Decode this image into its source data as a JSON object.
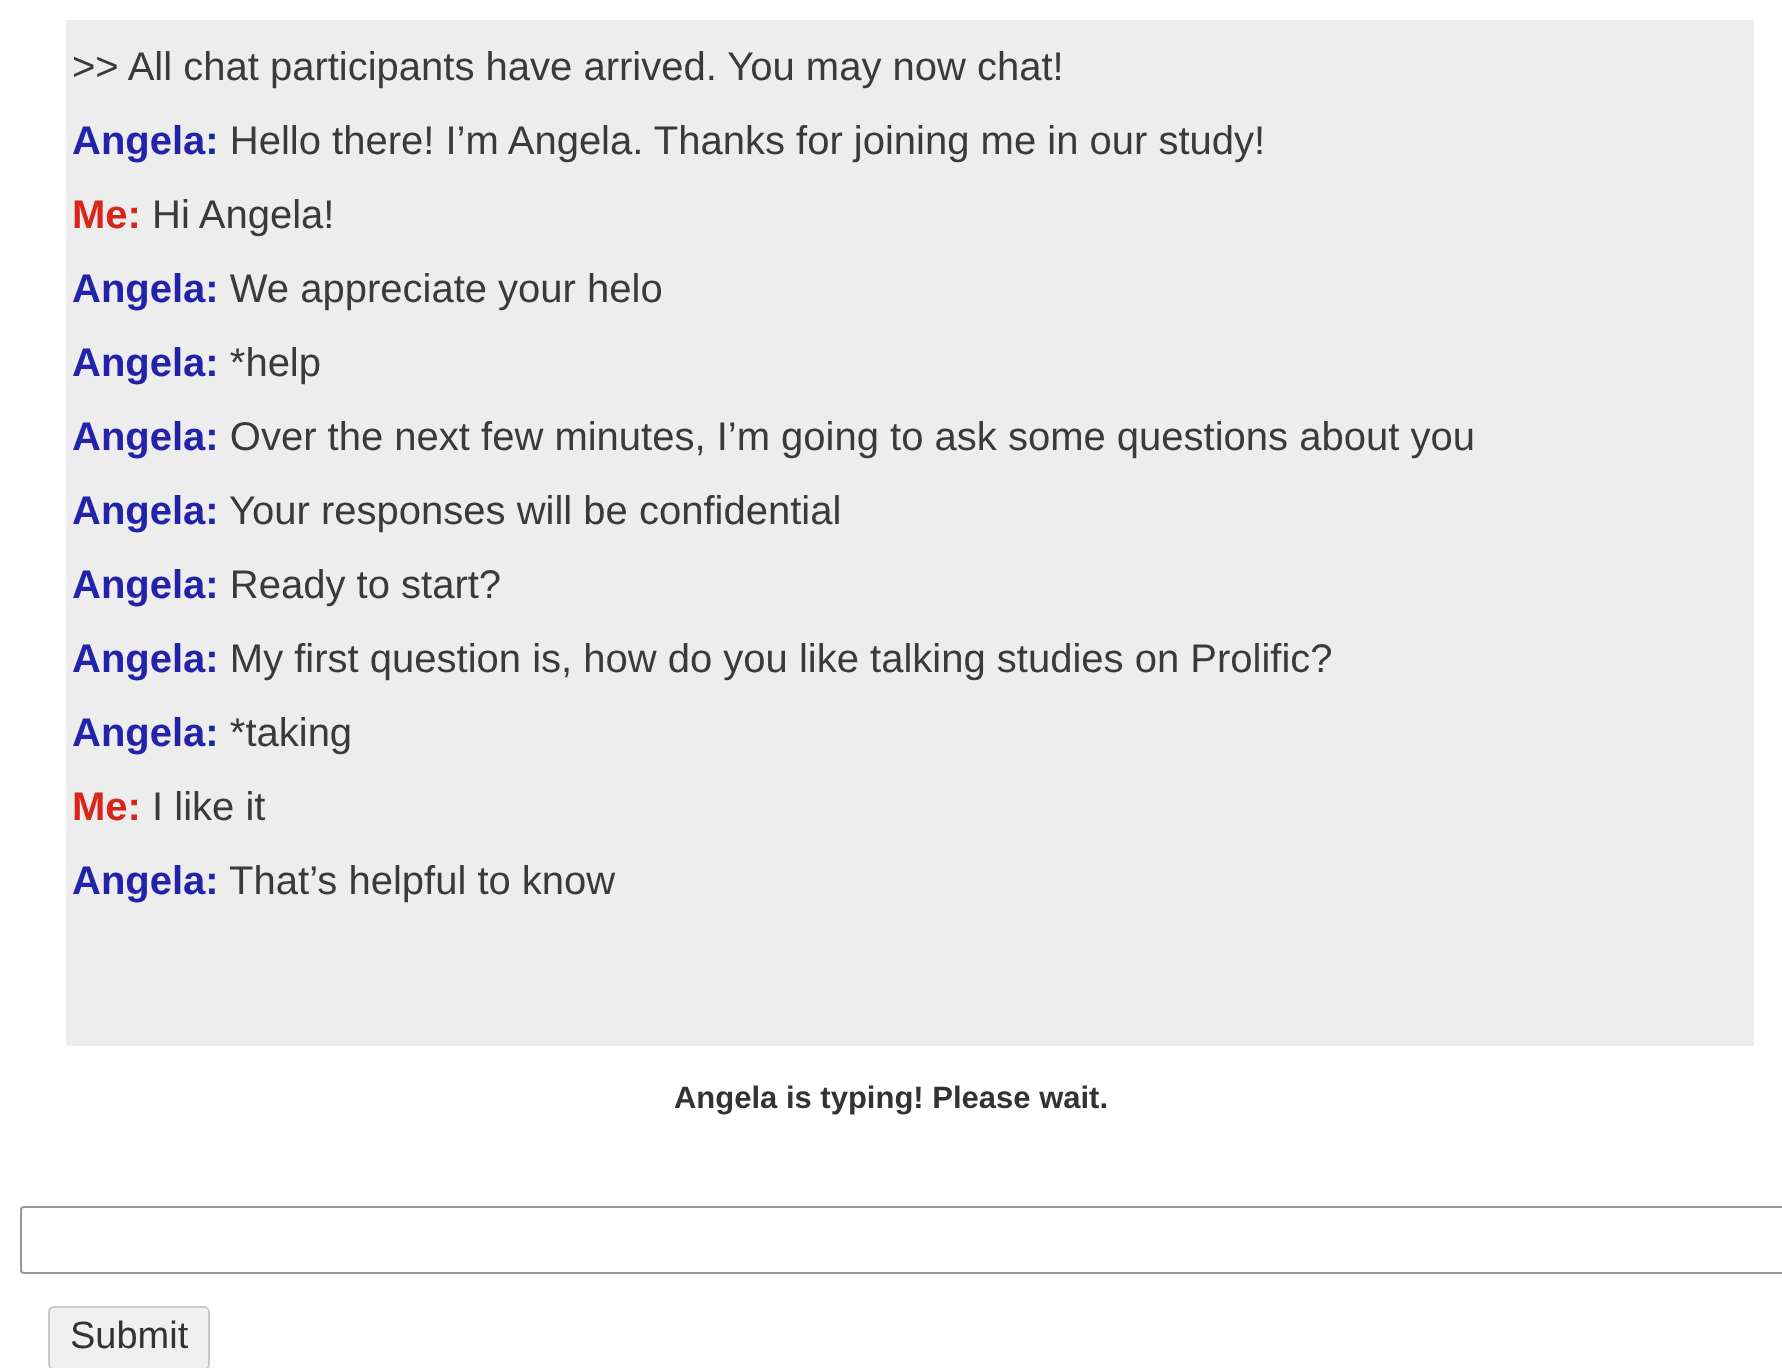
{
  "chat": {
    "messages": [
      {
        "kind": "system",
        "text": ">> All chat participants have arrived. You may now chat!"
      },
      {
        "kind": "partner",
        "speaker": "Angela:",
        "text": "Hello there! I’m Angela. Thanks for joining me in our study!"
      },
      {
        "kind": "self",
        "speaker": "Me:",
        "text": "Hi Angela!"
      },
      {
        "kind": "partner",
        "speaker": "Angela:",
        "text": "We appreciate your helo"
      },
      {
        "kind": "partner",
        "speaker": "Angela:",
        "text": "*help"
      },
      {
        "kind": "partner",
        "speaker": "Angela:",
        "text": "Over the next few minutes, I’m going to ask some questions about you"
      },
      {
        "kind": "partner",
        "speaker": "Angela:",
        "text": "Your responses will be confidential"
      },
      {
        "kind": "partner",
        "speaker": "Angela:",
        "text": "Ready to start?"
      },
      {
        "kind": "partner",
        "speaker": "Angela:",
        "text": "My first question is, how do you like talking studies on Prolific?"
      },
      {
        "kind": "partner",
        "speaker": "Angela:",
        "text": "*taking"
      },
      {
        "kind": "self",
        "speaker": "Me:",
        "text": "I like it"
      },
      {
        "kind": "partner",
        "speaker": "Angela:",
        "text": "That’s helpful to know"
      }
    ]
  },
  "status": "Angela is typing! Please wait.",
  "submit_button": "Submit"
}
